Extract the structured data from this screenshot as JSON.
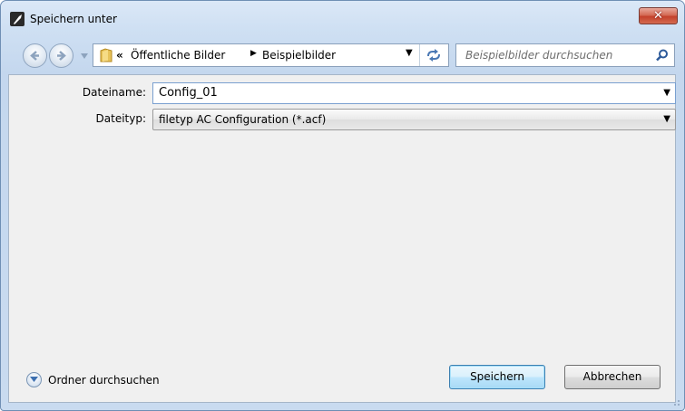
{
  "window": {
    "title": "Speichern unter",
    "close_glyph": "✕",
    "accent": "#c4412b"
  },
  "nav": {
    "back_icon": "back-arrow-icon",
    "forward_icon": "forward-arrow-icon",
    "breadcrumb_prefix": "«",
    "breadcrumb": [
      "Öffentliche Bilder",
      "Beispielbilder"
    ],
    "breadcrumb_separator": "▶",
    "dropdown_glyph": "▼",
    "refresh_icon": "refresh-icon"
  },
  "search": {
    "placeholder": "Beispielbilder durchsuchen"
  },
  "form": {
    "filename_label": "Dateiname:",
    "filename_value": "Config_01",
    "filetype_label": "Dateityp:",
    "filetype_value": "filetyp AC Configuration (*.acf)"
  },
  "footer": {
    "browse_label": "Ordner durchsuchen",
    "save_label": "Speichern",
    "cancel_label": "Abbrechen"
  }
}
